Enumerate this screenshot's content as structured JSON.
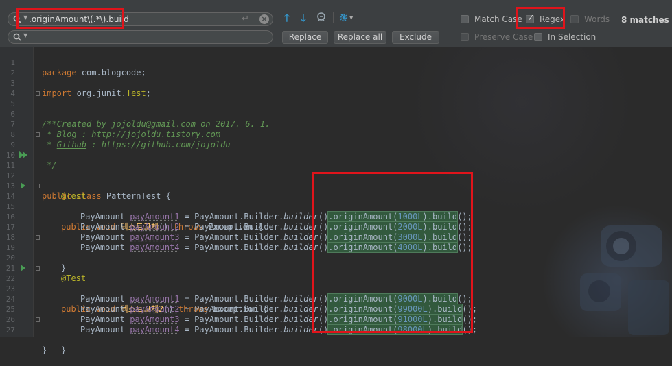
{
  "find": {
    "search_value": ".originAmount\\(.*\\).build",
    "replace_value": "",
    "match_count": "8 matches",
    "options": {
      "match_case": "Match Case",
      "regex": "Regex",
      "words": "Words",
      "preserve_case": "Preserve Case",
      "in_selection": "In Selection"
    },
    "buttons": {
      "replace": "Replace",
      "replace_all": "Replace all",
      "exclude": "Exclude"
    }
  },
  "editor": {
    "lines": [
      {
        "n": "1"
      },
      {
        "n": "2"
      },
      {
        "n": "3"
      },
      {
        "n": "4"
      },
      {
        "n": "5"
      },
      {
        "n": "6"
      },
      {
        "n": "7"
      },
      {
        "n": "8"
      },
      {
        "n": "9"
      },
      {
        "n": "10"
      },
      {
        "n": "11"
      },
      {
        "n": "12"
      },
      {
        "n": "13"
      },
      {
        "n": "14"
      },
      {
        "n": "15"
      },
      {
        "n": "16"
      },
      {
        "n": "17"
      },
      {
        "n": "18"
      },
      {
        "n": "19"
      },
      {
        "n": "20"
      },
      {
        "n": "21"
      },
      {
        "n": "22"
      },
      {
        "n": "23"
      },
      {
        "n": "24"
      },
      {
        "n": "25"
      },
      {
        "n": "26"
      },
      {
        "n": "27"
      }
    ],
    "code": {
      "l1_kw": "package",
      "l1_rest": " com.blogcode;",
      "l3_kw": "import",
      "l3_pkg": " org.junit.",
      "l3_cls": "Test",
      "l3_end": ";",
      "l5": "/**",
      "l6": " * Created by jojoldu@gmail.com on 2017. 6. 1.",
      "l7_a": " * Blog : http://",
      "l7_b": "jojoldu",
      "l7_c": ".",
      "l7_d": "tistory",
      "l7_e": ".com",
      "l8_a": " * ",
      "l8_b": "Github",
      "l8_c": " : https://github.com/jojoldu",
      "l9": " */",
      "l11_kw": "public class",
      "l11_rest": " PatternTest {",
      "annotation": "@Test",
      "l14_kw": "public void",
      "l14_name": "텍스트교체",
      "l14_mid": "() ",
      "throws": "throws",
      "exception": " Exception {",
      "l22_name": "텍스트교체2",
      "indent_type": "PayAmount ",
      "eq_builder": " = PayAmount.Builder.",
      "builder": "builder",
      "paren": "()",
      "close_brace": "}",
      "vars": [
        "payAmount1",
        "payAmount2",
        "payAmount3",
        "payAmount4"
      ],
      "match_prefix": ".originAmount(",
      "match_suffix": ").build",
      "tail": "();",
      "block1_nums": [
        "1000L",
        "2000L",
        "3000L",
        "4000L"
      ],
      "block2_nums": [
        "9000L",
        "99000L",
        "91000L",
        "98000L"
      ]
    }
  },
  "colors": {
    "highlight_box": "#e0141b",
    "match_bg": "#32593d",
    "accent": "#3592c4"
  }
}
